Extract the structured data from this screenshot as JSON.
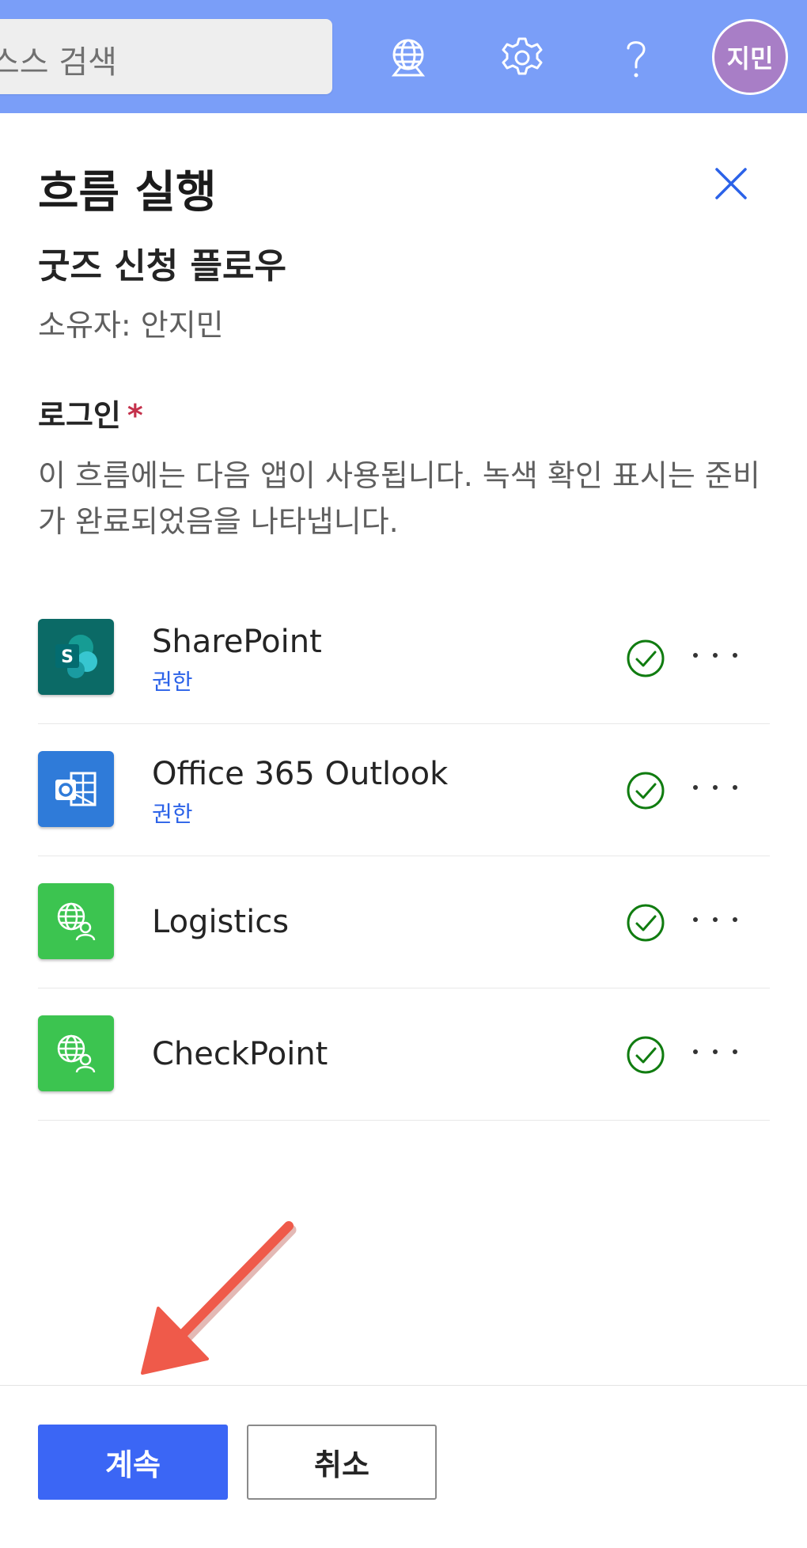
{
  "topbar": {
    "search_placeholder": "스스 검색",
    "icons": [
      "globe-icon",
      "gear-icon",
      "help-icon"
    ],
    "avatar_initials": "지민",
    "background": "#7a9ef8",
    "avatar_color": "#a87ec6"
  },
  "panel": {
    "title": "흐름 실행",
    "flow_name": "굿즈 신청 플로우",
    "owner": "소유자: 안지민",
    "section_label": "로그인",
    "required_marker": "*",
    "description": "이 흐름에는 다음 앱이 사용됩니다. 녹색 확인 표시는 준비가 완료되었음을 나타냅니다."
  },
  "connections": [
    {
      "name": "SharePoint",
      "link": "권한",
      "icon": "sharepoint-icon",
      "status": "ready"
    },
    {
      "name": "Office 365 Outlook",
      "link": "권한",
      "icon": "outlook-icon",
      "status": "ready"
    },
    {
      "name": "Logistics",
      "icon": "custom-connector-icon",
      "status": "ready"
    },
    {
      "name": "CheckPoint",
      "icon": "custom-connector-icon",
      "status": "ready"
    }
  ],
  "footer": {
    "continue_label": "계속",
    "cancel_label": "취소"
  },
  "colors": {
    "accent": "#3b66f5",
    "link": "#2b62e8",
    "success": "#107c10",
    "required": "#c4314b",
    "annotation_arrow": "#ef5a4a"
  }
}
